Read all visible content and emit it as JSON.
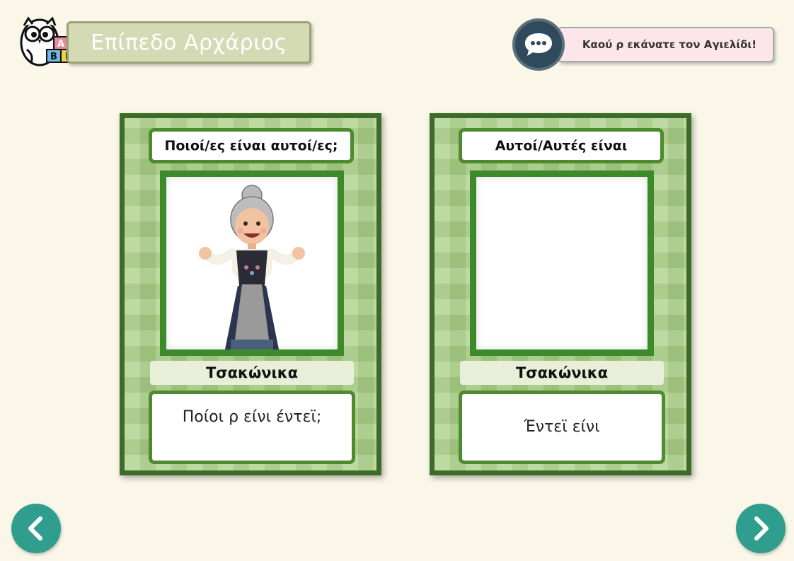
{
  "header": {
    "level_title": "Επίπεδο Αρχάριος",
    "logo_letters": [
      "Α",
      "Β",
      "Γ"
    ]
  },
  "message": {
    "text": "Καού ρ εκάνατε τον Αγιελίδι!"
  },
  "cards": {
    "left": {
      "header": "Ποιοί/ες είναι αυτοί/ες;",
      "image": "elderly-woman-illustration",
      "language": "Τσακώνικα",
      "text": "Ποίοι ρ είνι έντεϊ;"
    },
    "right": {
      "header": "Αυτοί/Αυτές είναι",
      "image": "empty",
      "language": "Τσακώνικα",
      "text": "Έντεϊ είνι"
    }
  },
  "nav": {
    "prev_icon": "chevron-left-icon",
    "next_icon": "chevron-right-icon"
  },
  "colors": {
    "background": "#faf6e8",
    "card_green": "#a9cf86",
    "card_border": "#3d6b28",
    "banner": "#d4dbb4",
    "bubble": "#fce6ec",
    "nav_button": "#2f9e8e"
  }
}
